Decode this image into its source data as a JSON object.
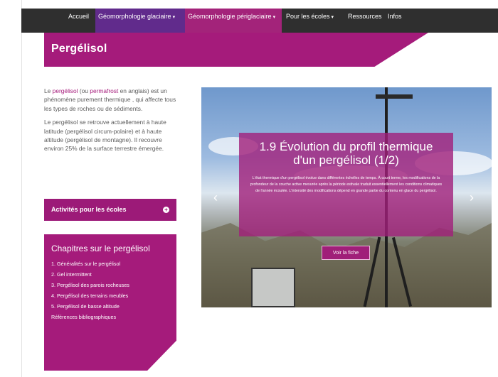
{
  "nav": {
    "items": [
      {
        "label": "Accueil"
      },
      {
        "label": "Géomorphologie glaciaire",
        "caret": "▾"
      },
      {
        "label": "Géomorphologie périglaciaire",
        "caret": "▾"
      },
      {
        "label": "Pour les écoles",
        "caret": "▾"
      },
      {
        "label": "Ressources"
      },
      {
        "label": "Infos"
      }
    ]
  },
  "page": {
    "title": "Pergélisol"
  },
  "intro": {
    "p1": [
      {
        "text": "Le "
      },
      {
        "text": "pergélisol",
        "link": true
      },
      {
        "text": " (ou "
      },
      {
        "text": "permafrost",
        "link": true
      },
      {
        "text": " en anglais) est un phénomène purement thermique , qui affecte tous les types de roches ou de sédiments."
      }
    ],
    "p2": "Le pergélisol se retrouve actuellement à haute latitude (pergélisol circum-polaire) et à haute altitude (pergélisol de montagne). Il recouvre environ 25% de la surface terrestre émergée."
  },
  "activities": {
    "label": "Activités pour les écoles",
    "icon": "plus-circle-icon"
  },
  "chapters": {
    "title": "Chapitres sur le pergélisol",
    "items": [
      "1. Généralités sur le pergélisol",
      "2. Gel intermittent",
      "3. Pergélisol des parois rocheuses",
      "4. Pergélisol des terrains meubles",
      "5. Pergélisol de basse altitude",
      "Références bibliographiques"
    ]
  },
  "slider": {
    "caption_title": "1.9 Évolution du profil thermique d'un pergélisol (1/2)",
    "caption_text": "L'état thermique d'un pergélisol évolue dans différentes échelles de temps. À court terme, les modifications de la profondeur de la couche active mesurée après la période estivale traduit essentiellement les conditions climatiques de l'année écoulée. L'intensité des modifications dépend en grande partie du contenu en glace du pergélisol.",
    "button_label": "Voir la fiche",
    "prev": "‹",
    "next": "›"
  },
  "colors": {
    "brand": "#a51b7b",
    "nav_bg": "#2f2f2f",
    "nav_active": "#612b8c"
  }
}
